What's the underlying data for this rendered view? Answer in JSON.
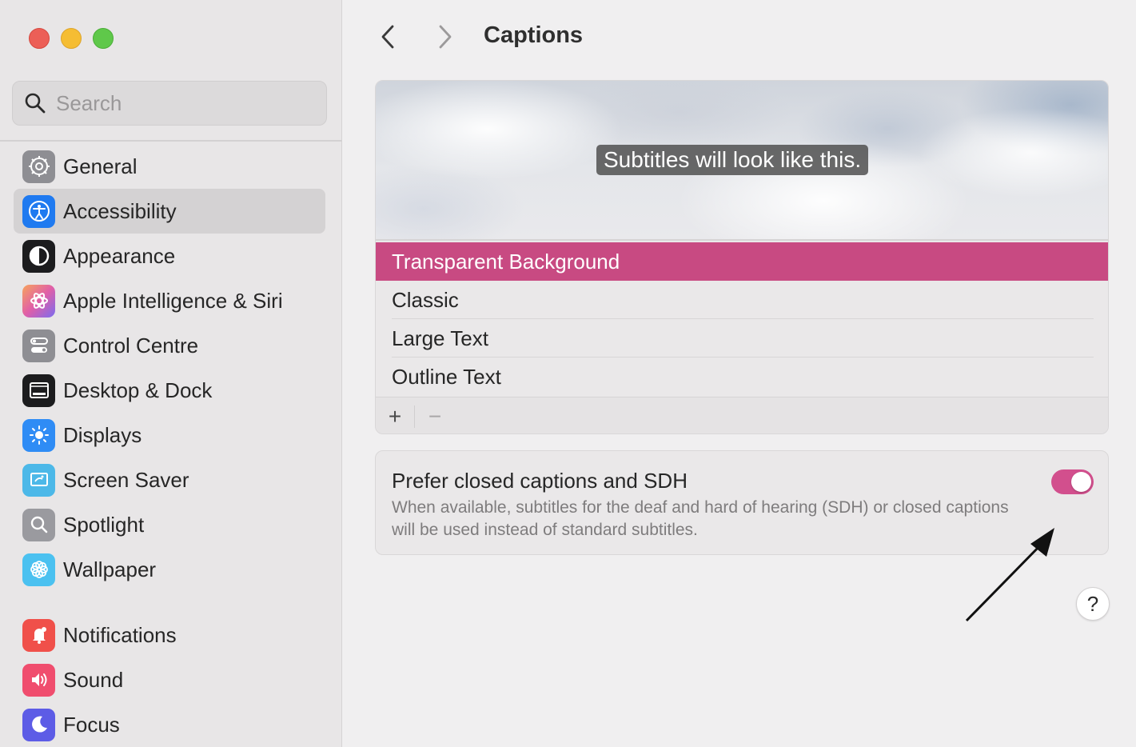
{
  "window": {
    "controls": [
      "close",
      "minimize",
      "zoom"
    ]
  },
  "sidebar": {
    "search_placeholder": "Search",
    "items": [
      {
        "label": "General",
        "icon": "gear-icon",
        "color": "#8e8e93",
        "selected": false
      },
      {
        "label": "Accessibility",
        "icon": "accessibility-icon",
        "color": "#1f7af0",
        "selected": true
      },
      {
        "label": "Appearance",
        "icon": "appearance-icon",
        "color": "#1c1c1e",
        "selected": false
      },
      {
        "label": "Apple Intelligence & Siri",
        "icon": "siri-icon",
        "color": "#e05fa8",
        "selected": false
      },
      {
        "label": "Control Centre",
        "icon": "control-centre-icon",
        "color": "#8e8e93",
        "selected": false
      },
      {
        "label": "Desktop & Dock",
        "icon": "dock-icon",
        "color": "#1c1c1e",
        "selected": false
      },
      {
        "label": "Displays",
        "icon": "sun-icon",
        "color": "#2f8cf5",
        "selected": false
      },
      {
        "label": "Screen Saver",
        "icon": "screen-saver-icon",
        "color": "#4cb8e8",
        "selected": false
      },
      {
        "label": "Spotlight",
        "icon": "spotlight-icon",
        "color": "#9a9a9f",
        "selected": false
      },
      {
        "label": "Wallpaper",
        "icon": "flower-icon",
        "color": "#4bc1f0",
        "selected": false
      },
      {
        "label": "Notifications",
        "icon": "bell-icon",
        "color": "#f0504a",
        "selected": false
      },
      {
        "label": "Sound",
        "icon": "speaker-icon",
        "color": "#f04d6e",
        "selected": false
      },
      {
        "label": "Focus",
        "icon": "moon-icon",
        "color": "#5d5ce6",
        "selected": false
      }
    ]
  },
  "main": {
    "title": "Captions",
    "preview_text": "Subtitles will look like this.",
    "styles": [
      {
        "label": "Transparent Background",
        "selected": true
      },
      {
        "label": "Classic",
        "selected": false
      },
      {
        "label": "Large Text",
        "selected": false
      },
      {
        "label": "Outline Text",
        "selected": false
      }
    ],
    "add_label": "+",
    "remove_label": "−",
    "pref": {
      "title": "Prefer closed captions and SDH",
      "description": "When available, subtitles for the deaf and hard of hearing (SDH) or closed captions will be used instead of standard subtitles.",
      "enabled": true
    },
    "help_label": "?"
  },
  "colors": {
    "accent": "#c84a82",
    "toggle_on": "#d24f8d"
  }
}
